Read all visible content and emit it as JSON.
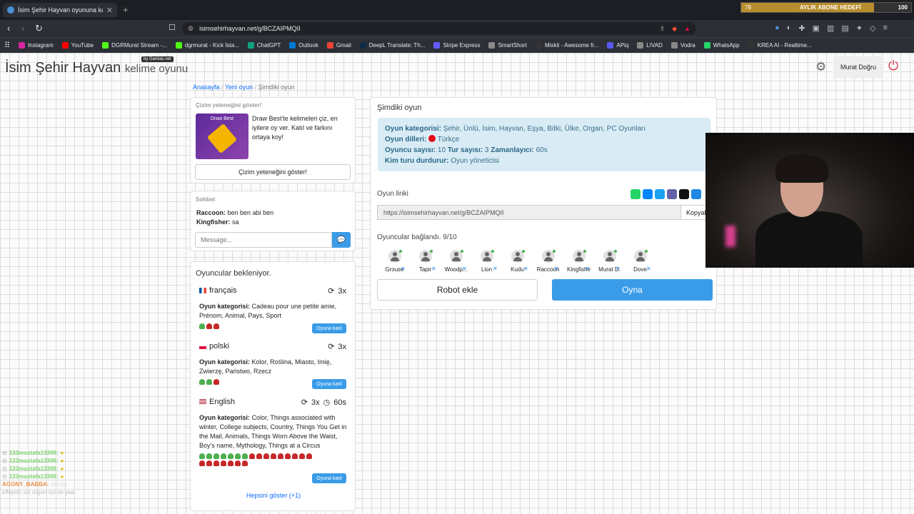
{
  "browser": {
    "tab_title": "İsim Şehir Hayvan oyununa katıl",
    "url": "isimsehirhayvan.net/g/BCZAIPMQII",
    "bookmarks": [
      "Instagram",
      "YouTube",
      "DGRMurat Stream -...",
      "dgrmurat - Kick İsta...",
      "ChatGPT",
      "Outlook",
      "Gmail",
      "DeepL Translate: Th...",
      "Stripe Express",
      "SmartShort",
      "Mixkit - Awesome fr...",
      "APiq",
      "LIVAD",
      "Vodra",
      "WhatsApp",
      "KREA AI - Realtime..."
    ],
    "bookmark_colors": [
      "#d6249f",
      "#ff0000",
      "#53fc18",
      "#53fc18",
      "#10a37f",
      "#0078d4",
      "#ea4335",
      "#0f2b46",
      "#635bff",
      "#888",
      "#333",
      "#5a5af0",
      "#888",
      "#888",
      "#25d366",
      "#333"
    ]
  },
  "sub_goal": {
    "left": "78",
    "label": "AYLIK ABONE HEDEFİ",
    "right": "100",
    "progress": 0.78
  },
  "header": {
    "brand": "İsim Şehir Hayvan",
    "brand_suffix": "kelime oyunu",
    "badge": "by Gamiac.net",
    "user": "Murat Doğru"
  },
  "breadcrumb": {
    "home": "Anasayfa",
    "new_game": "Yeni oyun",
    "current": "Şimdiki oyun"
  },
  "promo": {
    "title": "Çizim yeteneğini göster!",
    "img_label": "Draw Best",
    "text": "Draw Best'te kelimeleri çiz, en iyilere oy ver. Katıl ve farkını ortaya koy!",
    "button": "Çizim yeteneğini göster!"
  },
  "chat": {
    "title": "Sohbet",
    "messages": [
      {
        "user": "Raccoon:",
        "text": "ben ben abi ben"
      },
      {
        "user": "Kingfisher:",
        "text": "sa"
      }
    ],
    "placeholder": "Message..."
  },
  "waiting": {
    "title": "Oyuncular bekleniyor.",
    "games": [
      {
        "lang": "français",
        "rounds": "3x",
        "cat_label": "Oyun kategorisi:",
        "cats": "Cadeau pour une petite amie, Prénom, Animal, Pays, Sport",
        "green": 1,
        "red": 2,
        "join": "Oyuna katıl"
      },
      {
        "lang": "polski",
        "rounds": "3x",
        "cat_label": "Oyun kategorisi:",
        "cats": "Kolor, Roślina, Miasto, Imię, Zwierzę, Państwo, Rzecz",
        "green": 2,
        "red": 1,
        "join": "Oyuna katıl"
      },
      {
        "lang": "English",
        "rounds": "3x",
        "timer": "60s",
        "cat_label": "Oyun kategorisi:",
        "cats": "Color, Things associated with winter, College subjects, Country, Things You Get in the Mail, Animals, Things Worn Above the Waist, Boy's name, Mythology, Things at a Circus",
        "green": 7,
        "red": 16,
        "join": "Oyuna katıl"
      }
    ],
    "show_all": "Hepsini göster (+1)"
  },
  "current_game": {
    "title": "Şimdiki oyun",
    "cat_label": "Oyun kategorisi:",
    "cats": "Şehir, Ünlü, İsim, Hayvan, Eşya, Bitki, Ülke, Organ, PC Oyunları",
    "lang_label": "Oyun dilleri:",
    "lang": "Türkçe",
    "players_label": "Oyuncu sayısı:",
    "players": "10",
    "rounds_label": "Tur sayısı:",
    "rounds": "3",
    "timer_label": "Zamanlayıcı:",
    "timer": "60s",
    "stopper_label": "Kim turu durdurur:",
    "stopper": "Oyun yöneticisi",
    "link_label": "Oyun linki",
    "link": "https://isimsehirhayvan.net/g/BCZAIPMQII",
    "copy": "Kopyala",
    "connected": "Oyuncular bağlandı. 9/10",
    "player_names": [
      "Grouse",
      "Tapir",
      "Woodp...",
      "Lion",
      "Kudu",
      "Raccoon",
      "Kingfishe",
      "Murat D.",
      "Dove"
    ],
    "robot": "Robot ekle",
    "play": "Oyna",
    "share_colors": [
      "#25d366",
      "#0084ff",
      "#1da1f2",
      "#6264a7",
      "#111",
      "#1e88e5"
    ]
  },
  "overlay_chat": {
    "lines": [
      "133mustafa13306:",
      "133mustafa13306:",
      "133mustafa13306:",
      "133mustafa13306:"
    ],
    "last_user": "AGONY_BABBA:",
    "last_text": "hahaa",
    "bottom": "elfayim: siz orgun ıçıl ne yaa"
  }
}
